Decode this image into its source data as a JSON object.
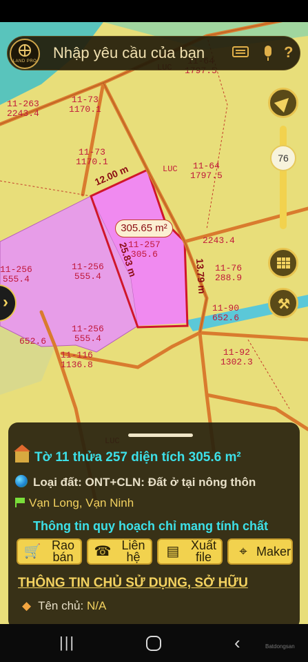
{
  "search": {
    "placeholder": "Nhập yêu cầu của bạn"
  },
  "logo": {
    "text": "LAND PRO"
  },
  "map": {
    "zoom_level": "76",
    "area_badge": "305.65 m²",
    "dimensions": [
      "12.00 m",
      "25.83 m",
      "13.79 m"
    ],
    "land_code": "LUC",
    "parcels": [
      {
        "id": "11-73",
        "area": "1170.1"
      },
      {
        "id": "11-73",
        "area": "1170.1"
      },
      {
        "id": "11-64",
        "area": "1797.5"
      },
      {
        "id": "11-64",
        "area": "1797.5"
      },
      {
        "id": "11-263",
        "area": "2243.4"
      },
      {
        "id": "11-257",
        "area": "305.6"
      },
      {
        "id": "11-256",
        "area": "555.4"
      },
      {
        "id": "11-256",
        "area": "555.4"
      },
      {
        "id": "11-256",
        "area": "555.4"
      },
      {
        "id": "11-76",
        "area": "288.9"
      },
      {
        "id": "11-90",
        "area": "652.6"
      },
      {
        "id": "11-92",
        "area": "1302.3"
      },
      {
        "id": "11-116",
        "area": "1136.8"
      },
      {
        "id": "",
        "area": "2243.4"
      },
      {
        "id": "",
        "area": "652.6"
      }
    ]
  },
  "info": {
    "title": "Tờ 11 thửa 257 diện tích 305.6 m²",
    "land_type": "Loại đất: ONT+CLN: Đất ở tại nông thôn",
    "location": "Vạn Long, Vạn Ninh",
    "notice": "Thông tin quy hoạch chỉ mang tính chất",
    "buttons": {
      "post": "Rao bán",
      "contact": "Liên hệ",
      "export": "Xuất file",
      "maker": "Maker"
    },
    "owner_heading": "THÔNG TIN CHỦ SỬ DỤNG, SỞ HỮU",
    "owner_name_label": "Tên chủ:",
    "owner_name_value": "N/A"
  },
  "watermark": "Batdongsan"
}
